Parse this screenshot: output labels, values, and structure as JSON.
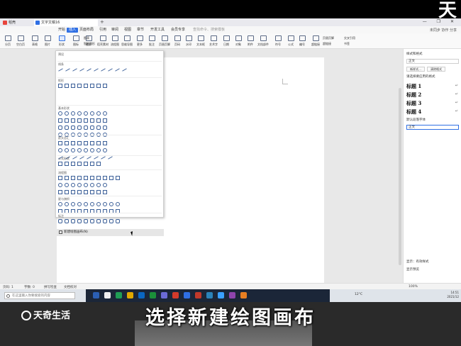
{
  "watermark_top": "天",
  "titlebar": {
    "tab_home": "稻壳",
    "tab_doc": "文字文稿16",
    "add_tab": "+",
    "window_controls": "— ❐ ✕"
  },
  "menubar": {
    "items": [
      "开始",
      "插入",
      "页面布局",
      "引用",
      "审阅",
      "视图",
      "章节",
      "开发工具",
      "会员专享"
    ],
    "active_index": 1,
    "search_hint": "查找命令、搜索模板",
    "right": "未同步  协作  分享"
  },
  "ribbon": {
    "buttons": [
      "分页",
      "空白页",
      "表格",
      "图片",
      "形状",
      "图标",
      "截屏",
      "稻壳素材",
      "流程图",
      "思维导图",
      "更多",
      "批注",
      "页眉页脚",
      "页码",
      "水印",
      "文本框",
      "艺术字",
      "日期",
      "对象",
      "附件",
      "文档部件",
      "符号",
      "公式",
      "编号",
      "超链接"
    ],
    "selected_index": 4,
    "small_labels": [
      "图表",
      "智能图形",
      "页眉页脚",
      "超链接",
      "交叉引用",
      "书签"
    ]
  },
  "shapes_panel": {
    "sections": [
      "预设",
      "线条",
      "矩形",
      "基本形状",
      "箭头总汇",
      "公式形状",
      "流程图",
      "星与旗帜",
      "标注"
    ],
    "new_canvas": "新建绘图画布(N)"
  },
  "right_pane": {
    "title": "样式和格式",
    "current_label": "正文",
    "buttons": [
      "新样式...",
      "清除格式"
    ],
    "apply_label": "请选择要应用的格式",
    "headings": [
      "标题 1",
      "标题 2",
      "标题 3",
      "标题 4"
    ],
    "default_font": "默认段落字体",
    "body": "正文",
    "show_label": "显示：有效样式",
    "preview_label": "显示预览"
  },
  "statusbar": {
    "page": "页码: 1",
    "words": "字数: 0",
    "spell": "拼写检查",
    "proof": "文档校对",
    "zoom": "100%"
  },
  "taskbar": {
    "search_placeholder": "在这里输入你要搜索的内容",
    "tray": "12°C",
    "time": "14:51",
    "date": "2021/12"
  },
  "caption": "选择新建绘图画布",
  "logo_text": "天奇生活"
}
